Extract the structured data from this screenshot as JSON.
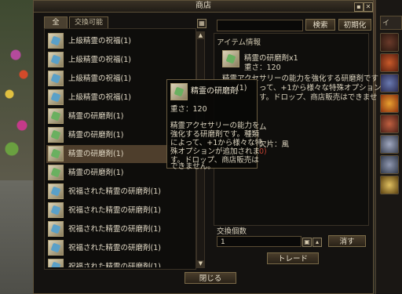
{
  "window": {
    "title": "商店"
  },
  "tabs": [
    {
      "label": "全",
      "active": true
    },
    {
      "label": "交換可能",
      "active": false
    }
  ],
  "list": {
    "items": [
      {
        "label": "上級精霊の祝福(1)",
        "icon": "blessing-scroll-icon"
      },
      {
        "label": "上級精霊の祝福(1)",
        "icon": "blessing-scroll-icon"
      },
      {
        "label": "上級精霊の祝福(1)",
        "icon": "blessing-scroll-icon"
      },
      {
        "label": "上級精霊の祝福(1)",
        "icon": "blessing-scroll-icon"
      },
      {
        "label": "精霊の研磨剤(1)",
        "icon": "polish-scroll-icon"
      },
      {
        "label": "精霊の研磨剤(1)",
        "icon": "polish-scroll-icon"
      },
      {
        "label": "精霊の研磨剤(1)",
        "icon": "polish-scroll-icon",
        "selected": true
      },
      {
        "label": "精霊の研磨剤(1)",
        "icon": "polish-scroll-icon"
      },
      {
        "label": "祝福された精霊の研磨剤(1)",
        "icon": "blessed-polish-scroll-icon"
      },
      {
        "label": "祝福された精霊の研磨剤(1)",
        "icon": "blessed-polish-scroll-icon"
      },
      {
        "label": "祝福された精霊の研磨剤(1)",
        "icon": "blessed-polish-scroll-icon"
      },
      {
        "label": "祝福された精霊の研磨剤(1)",
        "icon": "blessed-polish-scroll-icon"
      },
      {
        "label": "祝福された精霊の研磨剤(1)",
        "icon": "blessed-polish-scroll-icon"
      }
    ]
  },
  "search": {
    "value": "",
    "search_label": "検索",
    "reset_label": "初期化"
  },
  "info": {
    "header": "アイテム情報",
    "item_name": "精霊の研磨剤x1",
    "weight": "重さ：120",
    "desc_line1": "精霊アクセサリーの能力を強化する研磨剤です",
    "desc_line2": "って、+1から様々な特殊オプション",
    "desc_line3": "す。ドロップ、商店販売はできませ",
    "partial_1": "ム",
    "partial_2": "欠片：風",
    "partial_3": "0)"
  },
  "tooltip": {
    "title": "精霊の研磨剤",
    "count": "(1)",
    "weight": "重さ：120",
    "desc": [
      "精霊アクセサリーの能力を",
      "強化する研磨剤です。種類",
      "によって、+1から様々な特",
      "殊オプションが追加されま",
      "す。ドロップ、商店販売は",
      "できません。"
    ]
  },
  "exchange": {
    "label": "交換個数",
    "quantity": "1",
    "clear_label": "消す",
    "trade_label": "トレード"
  },
  "footer": {
    "close_label": "閉じる"
  },
  "side_panel": {
    "tab_label": "イ"
  }
}
